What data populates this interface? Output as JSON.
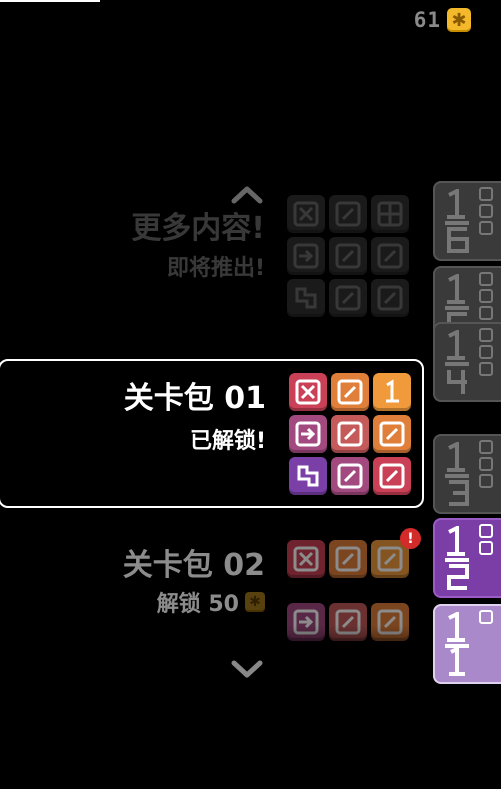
{
  "currency": {
    "amount": "61",
    "icon": "gear-coin-icon"
  },
  "nav": {
    "up_icon": "chevron-up-icon",
    "down_icon": "chevron-down-icon"
  },
  "packs": [
    {
      "title": "更多内容!",
      "subtitle": "即将推出!",
      "state": "coming-soon"
    },
    {
      "title": "关卡包 01",
      "subtitle": "已解锁!",
      "state": "unlocked"
    },
    {
      "title": "关卡包 02",
      "subtitle": "解锁 50",
      "state": "locked",
      "badge": "!"
    }
  ],
  "sidebar": {
    "tabs": [
      {
        "top": "1",
        "bottom": "6"
      },
      {
        "top": "1",
        "bottom": "5"
      },
      {
        "top": "1",
        "bottom": "4"
      },
      {
        "top": "1",
        "bottom": "3"
      },
      {
        "top": "1",
        "bottom": "2"
      },
      {
        "top": "1",
        "bottom": "1"
      }
    ]
  },
  "colors": {
    "red": "#c94057",
    "orange": "#e07f3a",
    "orange_light": "#f09a3c",
    "purple": "#7b3fa8",
    "magenta": "#a24a80",
    "coin": "#f4b92b"
  }
}
